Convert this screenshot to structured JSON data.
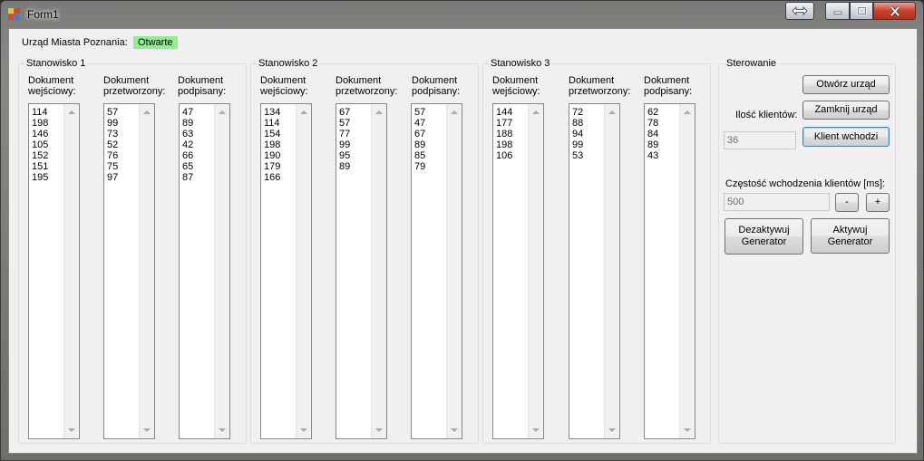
{
  "window": {
    "title": "Form1"
  },
  "header": {
    "office_label": "Urząd Miasta Poznania:",
    "status": "Otwarte"
  },
  "stations": [
    {
      "title": "Stanowisko 1",
      "columns": [
        {
          "header_l1": "Dokument",
          "header_l2": "wejściowy:",
          "values": "114\n198\n146\n105\n152\n151\n195"
        },
        {
          "header_l1": "Dokument",
          "header_l2": "przetworzony:",
          "values": "57\n99\n73\n52\n76\n75\n97"
        },
        {
          "header_l1": "Dokument",
          "header_l2": "podpisany:",
          "values": "47\n89\n63\n42\n66\n65\n87"
        }
      ]
    },
    {
      "title": "Stanowisko 2",
      "columns": [
        {
          "header_l1": "Dokument",
          "header_l2": "wejściowy:",
          "values": "134\n114\n154\n198\n190\n179\n166"
        },
        {
          "header_l1": "Dokument",
          "header_l2": "przetworzony:",
          "values": "67\n57\n77\n99\n95\n89"
        },
        {
          "header_l1": "Dokument",
          "header_l2": "podpisany:",
          "values": "57\n47\n67\n89\n85\n79"
        }
      ]
    },
    {
      "title": "Stanowisko 3",
      "columns": [
        {
          "header_l1": "Dokument",
          "header_l2": "wejściowy:",
          "values": "144\n177\n188\n198\n106"
        },
        {
          "header_l1": "Dokument",
          "header_l2": "przetworzony:",
          "values": "72\n88\n94\n99\n53"
        },
        {
          "header_l1": "Dokument",
          "header_l2": "podpisany:",
          "values": "62\n78\n84\n89\n43"
        }
      ]
    }
  ],
  "control": {
    "title": "Sterowanie",
    "open_button": "Otwórz urząd",
    "close_button": "Zamknij urząd",
    "clients_label": "Ilość klientów:",
    "clients_value": "36",
    "client_enters_button": "Klient wchodzi",
    "frequency_label": "Częstość wchodzenia klientów [ms]:",
    "frequency_value": "500",
    "minus_button": "-",
    "plus_button": "+",
    "deactivate_button_l1": "Dezaktywuj",
    "deactivate_button_l2": "Generator",
    "activate_button_l1": "Aktywuj",
    "activate_button_l2": "Generator"
  },
  "colors": {
    "status_bg": "#90ee90",
    "close_button": "#c8412b",
    "form_bg": "#f0f0f0"
  },
  "icons": [
    "app-icon",
    "swap-icon",
    "minimize-icon",
    "maximize-icon",
    "close-icon",
    "scroll-up-icon",
    "scroll-down-icon"
  ]
}
